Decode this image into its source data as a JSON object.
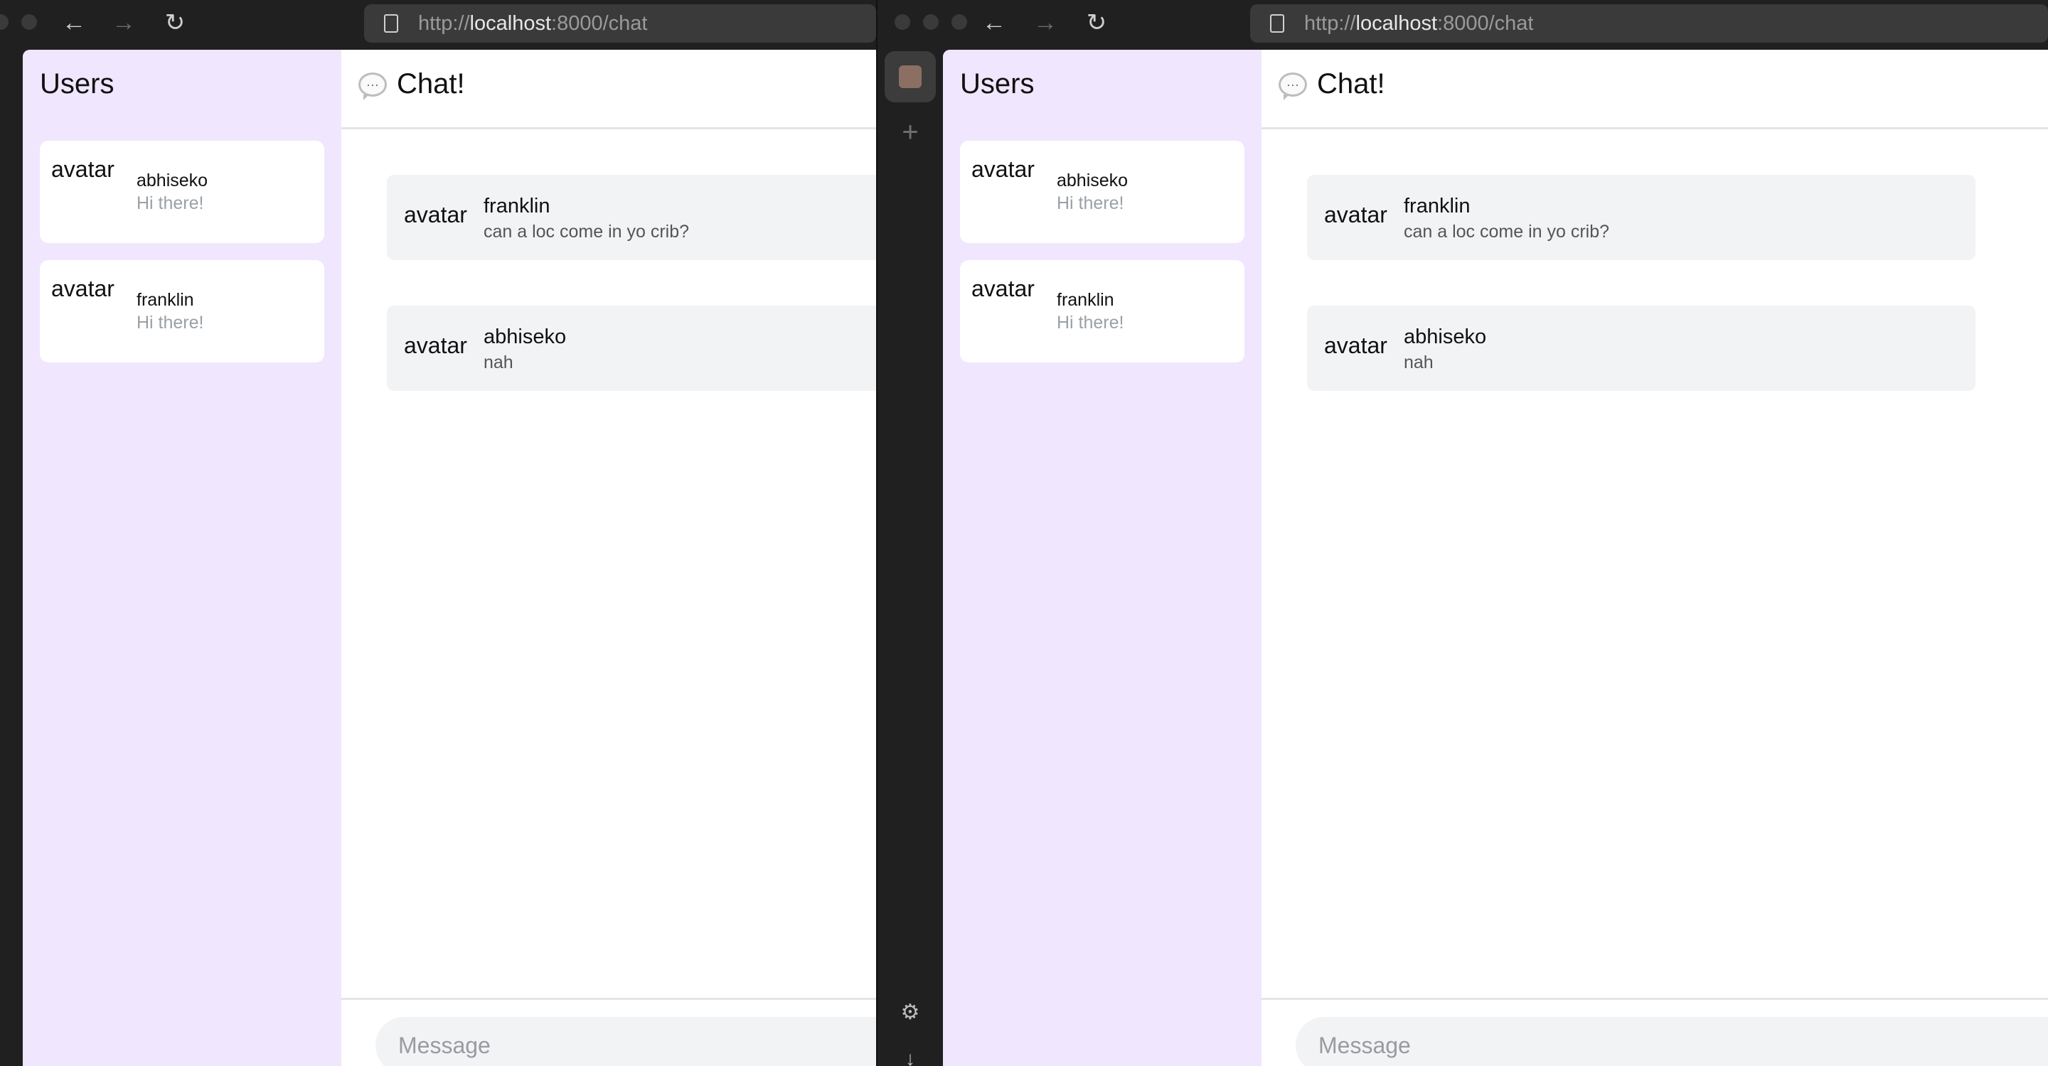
{
  "browser": {
    "url_prefix": "http://",
    "url_host": "localhost",
    "url_rest": ":8000/chat"
  },
  "icons": {
    "back": "←",
    "forward": "→",
    "reload": "↻",
    "plus": "+",
    "gear": "⚙",
    "download": "↓",
    "chat": "···"
  },
  "users_panel": {
    "title": "Users",
    "users": [
      {
        "avatar": "avatar",
        "name": "abhiseko",
        "preview": "Hi there!"
      },
      {
        "avatar": "avatar",
        "name": "franklin",
        "preview": "Hi there!"
      }
    ]
  },
  "chat": {
    "title": "Chat!",
    "messages": [
      {
        "avatar": "avatar",
        "author": "franklin",
        "text": "can a loc come in yo crib?"
      },
      {
        "avatar": "avatar",
        "author": "abhiseko",
        "text": "nah"
      }
    ],
    "input_placeholder": "Message"
  },
  "colors": {
    "users_panel_bg": "#f0e6fd",
    "message_bg": "#f2f3f5",
    "chrome_bg": "#202020"
  }
}
